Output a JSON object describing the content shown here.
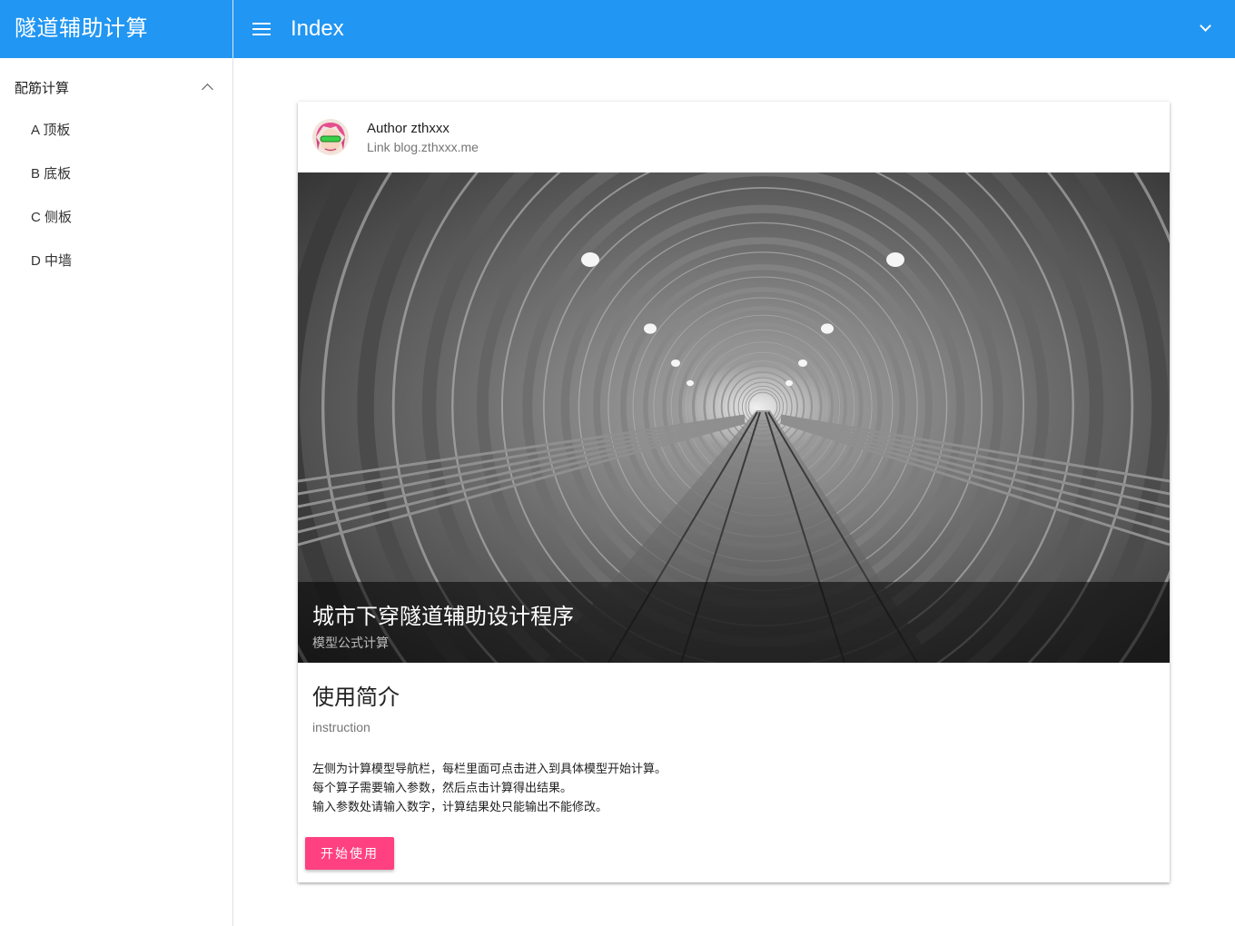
{
  "app": {
    "title": "隧道辅助计算",
    "accent": "#2196f3"
  },
  "header": {
    "menu_icon": "menu-icon",
    "title": "Index",
    "expand_icon": "chevron-down-icon"
  },
  "sidebar": {
    "group_label": "配筋计算",
    "group_icon": "chevron-up-icon",
    "items": [
      {
        "label": "A 顶板"
      },
      {
        "label": "B 底板"
      },
      {
        "label": "C 侧板"
      },
      {
        "label": "D 中墙"
      }
    ]
  },
  "card": {
    "author": "Author zthxxx",
    "link": "Link blog.zthxxx.me",
    "media_title": "城市下穿隧道辅助设计程序",
    "media_subtitle": "模型公式计算",
    "section_title": "使用简介",
    "section_subtitle": "instruction",
    "lines": [
      "左侧为计算模型导航栏，每栏里面可点击进入到具体模型开始计算。",
      "每个算子需要输入参数，然后点击计算得出结果。",
      "输入参数处请输入数字，计算结果处只能输出不能修改。"
    ],
    "button_label": "开始使用",
    "button_color": "#ff4081"
  }
}
